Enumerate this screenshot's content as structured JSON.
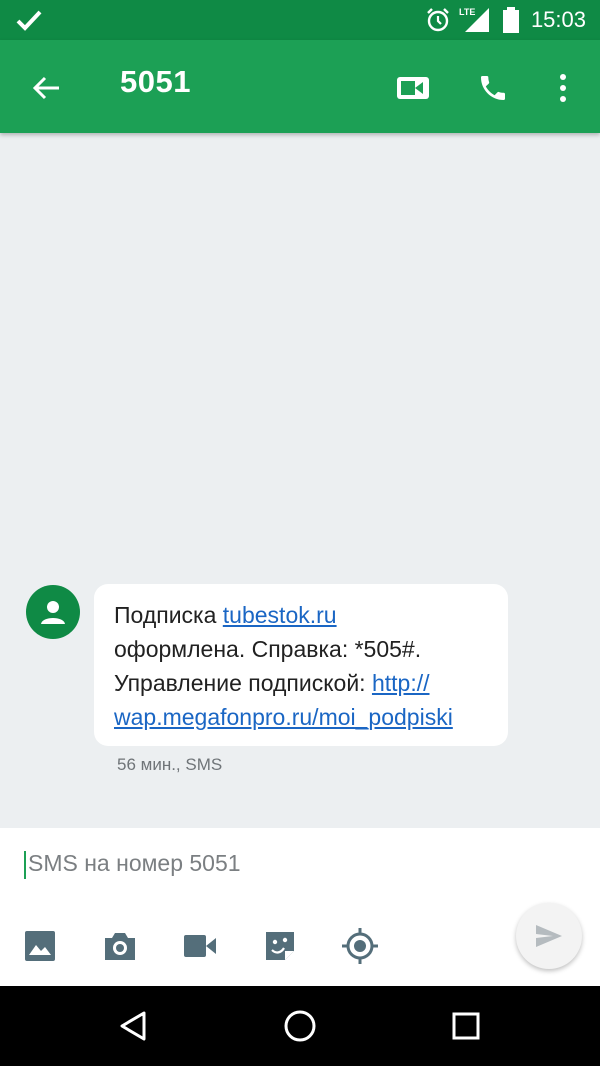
{
  "status_bar": {
    "time": "15:03",
    "network": "LTE",
    "icons": [
      "check-icon",
      "alarm-icon",
      "lte-signal-icon",
      "battery-icon"
    ]
  },
  "app_bar": {
    "title": "5051",
    "icons": [
      "back-arrow-icon",
      "video-call-icon",
      "phone-icon",
      "more-vert-icon"
    ]
  },
  "message": {
    "line1_text": "Подписка ",
    "line1_link": "tubestok.ru",
    "line2": "оформлена. Справка: *505#.",
    "line3_text": "Управление подпиской: ",
    "line3_link": "http://",
    "line4_link": "wap.megafonpro.ru/moi_podpiski",
    "meta": "56 мин., SMS"
  },
  "composer": {
    "placeholder": "SMS на номер 5051",
    "tools": [
      "gallery-icon",
      "camera-icon",
      "video-icon",
      "sticker-icon",
      "location-icon"
    ]
  },
  "nav_bar": {
    "icons": [
      "back-triangle-icon",
      "home-circle-icon",
      "recents-square-icon"
    ]
  },
  "colors": {
    "status_bar": "#0f8a45",
    "app_bar": "#1ca055",
    "background": "#eceff1",
    "link": "#1a66c4"
  }
}
